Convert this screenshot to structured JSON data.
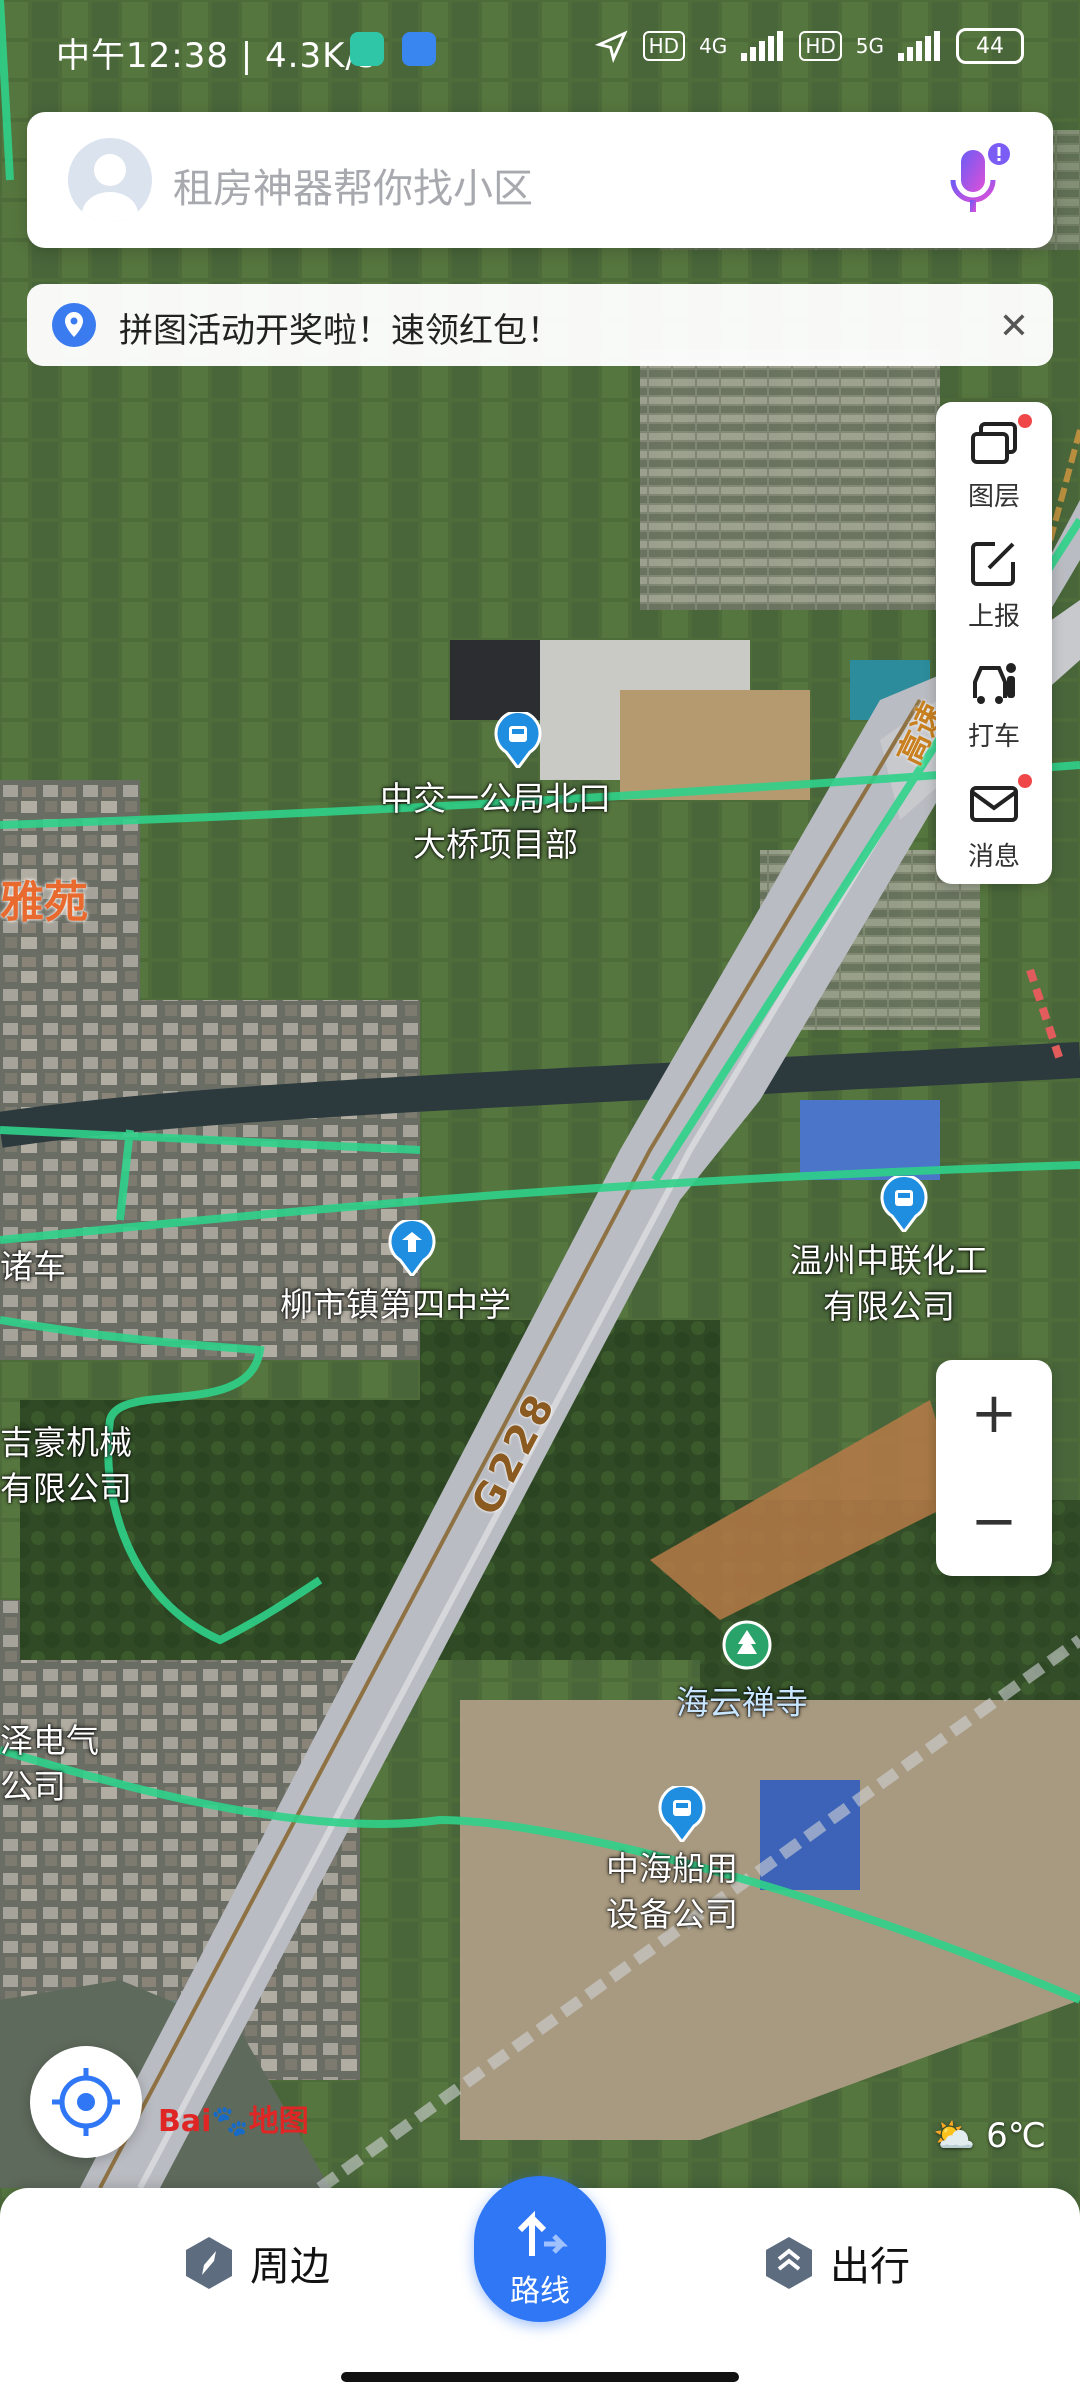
{
  "status_bar": {
    "time": "中午12:38 | 4.3K/s",
    "network": "4G",
    "network2": "5G",
    "hd1": "HD",
    "hd2": "HD",
    "battery": "44"
  },
  "search": {
    "placeholder": "租房神器帮你找小区"
  },
  "notice": {
    "text": "拼图活动开奖啦！速领红包！"
  },
  "tools": [
    {
      "label": "图层",
      "icon": "layers-icon"
    },
    {
      "label": "上报",
      "icon": "report-icon"
    },
    {
      "label": "打车",
      "icon": "taxi-icon"
    },
    {
      "label": "消息",
      "icon": "message-icon"
    }
  ],
  "zoom": {
    "in": "+",
    "out": "−"
  },
  "map_labels": {
    "poi_project": "中交一公局北口\n大桥项目部",
    "poi_yayuan": "雅苑",
    "poi_che": "诸车",
    "poi_school": "柳市镇第四中学",
    "poi_zhonglian": "温州中联化工\n有限公司",
    "poi_jihao": "吉豪机械\n有限公司",
    "poi_haiyun": "海云禅寺",
    "poi_zedianqi": "泽电气\n公司",
    "poi_zhonghai": "中海船用\n设备公司",
    "road_g228": "G228",
    "road_gaosu": "高速"
  },
  "logo": {
    "bai": "Bai",
    "du": "du",
    "ditu": "地图"
  },
  "weather": {
    "temp": "6℃"
  },
  "bottom_bar": {
    "nearby": "周边",
    "route": "路线",
    "travel": "出行"
  }
}
